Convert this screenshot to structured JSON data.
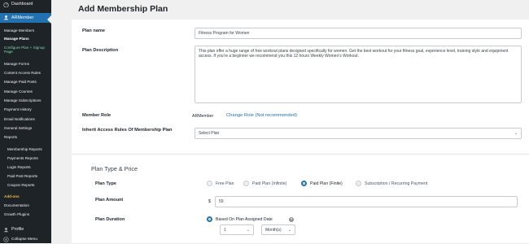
{
  "sidebar": {
    "dashboard": "Dashboard",
    "armember": "ARMember",
    "items": [
      "Manage Members",
      "Manage Plans",
      "Configure Plan + Signup Page",
      "Manage Forms",
      "Content Access Rules",
      "Manage Paid Posts",
      "Manage Courses",
      "Manage Subscriptions",
      "Payment History",
      "Email Notifications",
      "General Settings",
      "Reports",
      "Membership Reports",
      "Payments Reports",
      "Login Reports",
      "Paid Post Reports",
      "Coupon Reports",
      "Add-ons",
      "Documentation",
      "Growth Plugins"
    ],
    "profile": "Profile",
    "collapse": "Collapse Menu"
  },
  "page": {
    "title": "Add Membership Plan"
  },
  "form": {
    "plan_name_label": "Plan name",
    "plan_name_value": "Fitness Program for Women",
    "plan_description_label": "Plan Description",
    "plan_description_value": "This plan offer a huge range of free workout plans designed specifically for women. Get the best workout for your fitness goal, experience level, training style and equipment access. If you're a beginner we recommend you this 12 hours Weekly Women's Workout.",
    "member_role_label": "Member Role",
    "member_role_value": "ARMember",
    "change_role_link": "Change Role (Not recommended)",
    "inherit_label": "Inherit Access Rules Of Membership Plan",
    "inherit_value": "Select Plan",
    "section_title": "Plan Type & Price",
    "plan_type_label": "Plan Type",
    "plan_type_options": [
      "Free Plan",
      "Paid Plan (Infinite)",
      "Paid Plan (Finite)",
      "Subscription / Recurring Payment"
    ],
    "plan_amount_label": "Plan Amount",
    "currency": "$",
    "plan_amount_value": "59",
    "plan_duration_label": "Plan Duration",
    "duration_option": "Based On Plan Assigned Date",
    "duration_number": "1",
    "duration_unit": "Month(s)"
  },
  "colors": {
    "sidebar_bg": "#1d2327",
    "active_bg": "#2271b1",
    "link": "#2271b1"
  }
}
